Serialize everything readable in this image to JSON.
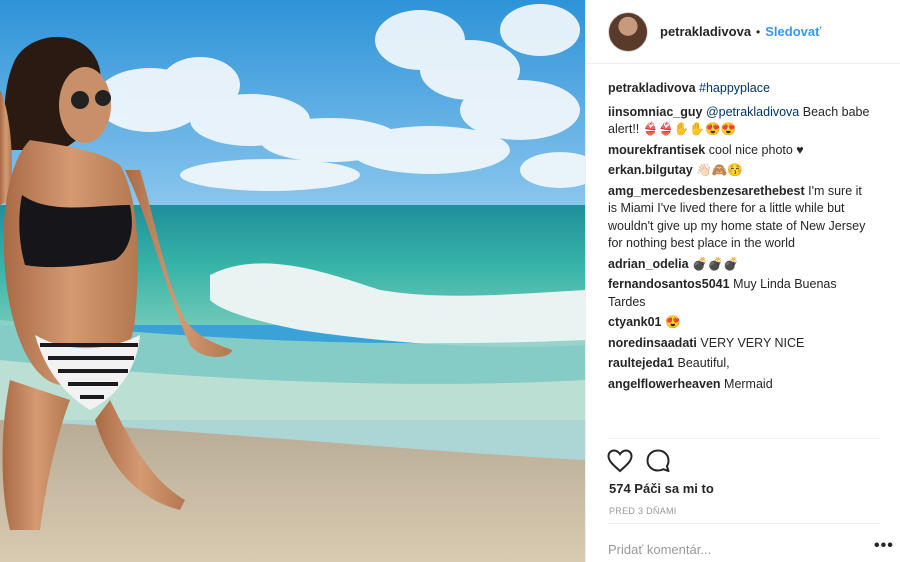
{
  "post": {
    "username": "petrakladivova",
    "follow_label": "Sledovať",
    "separator": "•",
    "caption": {
      "username": "petrakladivova",
      "text": "#happyplace"
    },
    "comments": [
      {
        "user": "iinsomniac_guy",
        "mention": "@petrakladivova",
        "text": " Beach babe alert!! 👙👙✋✋😍😍"
      },
      {
        "user": "mourekfrantisek",
        "mention": "",
        "text": "cool nice photo ♥"
      },
      {
        "user": "erkan.bilgutay",
        "mention": "",
        "text": "👋🏻🙈😚"
      },
      {
        "user": "amg_mercedesbenzesarethebest",
        "mention": "",
        "text": "I'm sure it is Miami I've lived there for a little while but wouldn't give up my home state of New Jersey for nothing best place in the world"
      },
      {
        "user": "adrian_odelia",
        "mention": "",
        "text": "💣💣💣"
      },
      {
        "user": "fernandosantos5041",
        "mention": "",
        "text": "Muy Linda Buenas Tardes"
      },
      {
        "user": "ctyank01",
        "mention": "",
        "text": "😍"
      },
      {
        "user": "noredinsaadati",
        "mention": "",
        "text": "VERY VERY NICE"
      },
      {
        "user": "raultejeda1",
        "mention": "",
        "text": "Beautiful,"
      },
      {
        "user": "angelflowerheaven",
        "mention": "",
        "text": "Mermaid"
      }
    ],
    "likes_text": "574 Páči sa mi to",
    "time_text": "PRED 3 DŇAMI",
    "add_comment_placeholder": "Pridať komentár...",
    "more_label": "•••"
  },
  "icons": {
    "like": "heart-icon",
    "comment": "comment-bubble-icon",
    "more": "more-options-icon"
  },
  "colors": {
    "accent": "#3897f0",
    "text": "#262626",
    "muted": "#999999",
    "divider": "#efefef"
  }
}
